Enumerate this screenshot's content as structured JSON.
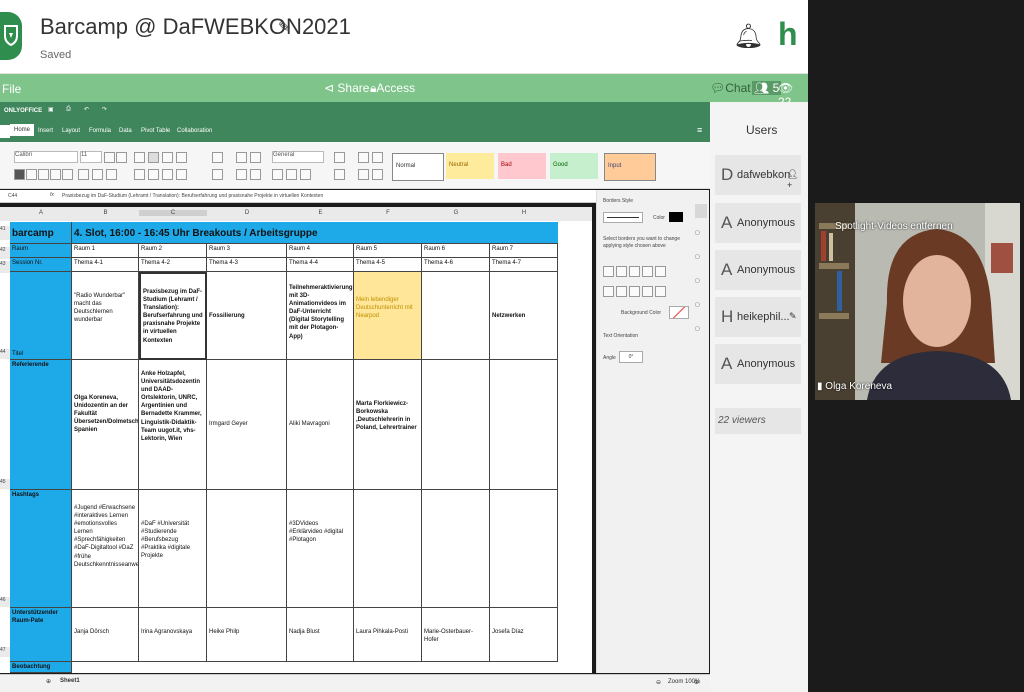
{
  "header": {
    "title": "Barcamp @ DaFWEBKON2021",
    "status": "Saved",
    "brand_letter": "h"
  },
  "menubar": {
    "file": "File",
    "share": "Share",
    "access": "Access",
    "chat": "Chat",
    "users": "5",
    "viewers": "22"
  },
  "office": {
    "app_name": "ONLYOFFICE",
    "tabs": [
      "Home",
      "Insert",
      "Layout",
      "Formula",
      "Data",
      "Pivot Table",
      "Collaboration"
    ],
    "font": "Calibri",
    "font_size": "11",
    "number_format": "General",
    "styles": [
      {
        "label": "Normal",
        "bg": "#ffffff",
        "color": "#222"
      },
      {
        "label": "Neutral",
        "bg": "#ffeb9c",
        "color": "#9c6500"
      },
      {
        "label": "Bad",
        "bg": "#ffc7ce",
        "color": "#9c0006"
      },
      {
        "label": "Good",
        "bg": "#c6efce",
        "color": "#006100"
      },
      {
        "label": "Input",
        "bg": "#ffcc99",
        "color": "#3f3f76"
      }
    ],
    "cell_ref": "C44",
    "formula": "Praxisbezug im DaF-Studium (Lehramt / Translation): Berufserfahrung und praxisnahe Projekte in virtuellen Kontexten"
  },
  "panel": {
    "borders_style": "Borders Style",
    "color": "Color",
    "hint": "Select borders you want to change applying style chosen above",
    "background_color": "Background Color",
    "text_orientation": "Text Orientation",
    "angle_label": "Angle",
    "angle_value": "0°"
  },
  "sheet": {
    "columns": [
      "A",
      "B",
      "C",
      "D",
      "E",
      "F",
      "G",
      "H"
    ],
    "rows": [
      "41",
      "42",
      "43",
      "44",
      "45",
      "46",
      "47"
    ],
    "title_a": "barcamp",
    "title_b": "4. Slot, 16:00 - 16:45 Uhr  Breakouts / Arbeitsgruppe",
    "raum_label": "Raum",
    "rooms": [
      "Raum 1",
      "Raum 2",
      "Raum 3",
      "Raum 4",
      "Raum 5",
      "Raum 6",
      "Raum 7"
    ],
    "session_label": "Session Nr.",
    "sessions": [
      "Thema 4-1",
      "Thema 4-2",
      "Thema 4-3",
      "Thema 4-4",
      "Thema 4-5",
      "Thema 4-6",
      "Thema 4-7"
    ],
    "titel_label": "Titel",
    "titles": [
      "\"Radio Wunderbar\" macht das Deutschlernen wunderbar",
      "Praxisbezug im DaF-Studium (Lehramt / Translation): Berufserfahrung und praxisnahe Projekte in virtuellen Kontexten",
      "Fossilierung",
      "Teilnehmeraktivierung mit 3D-Animationvideos im DaF-Unterricht (Digital Storytelling mit der Plotagon-App)",
      "Mein lebendiger Deutschunterricht mit Nearpod",
      "",
      "Netzwerken"
    ],
    "ref_label": "Referierende",
    "refs": [
      "Olga Koreneva, Unidozentin an der Fakultät Übersetzen/Dolmetschen, Spanien",
      "Anke Holzapfel, Universitätsdozentin und DAAD-Ortslektorin, UNRC, Argentinien und Bernadette Krammer, Linguistik-Didaktik-Team uugot.it, vhs-Lektorin, Wien",
      "Irmgard Geyer",
      "Aliki Mavragoni",
      "Marta Florkiewicz-Borkowska ,Deutschlehrerin in Poland, Lehrertrainer",
      "",
      ""
    ],
    "hashtag_label": "Hashtags",
    "hashtags": [
      "#Jugend #Erwachsene #interaktives Lernen #emotionsvolles Lernen #Sprechfähigkeiten #DaF-Digitaltool #DaZ #frühe Deutschkenntnisseanwendung",
      "#DaF #Universität #Studierende #Berufsbezug #Praktika #digitale Projekte",
      "",
      "#3DVideos #Erklärvideo #digital #Plotagon",
      "",
      "",
      ""
    ],
    "pate_label": "Unterstützender Raum-Pate",
    "paten": [
      "Janja Dörsch",
      "Irina Agranovskaya",
      "Heike Philp",
      "Nadja Blust",
      "Laura Pihkala-Posti",
      "Marie-Osterbauer-Hofer",
      "Josefa Díaz"
    ],
    "next_label": "Beobachtung"
  },
  "bottom": {
    "sheet_tab": "Sheet1",
    "zoom": "Zoom 100%"
  },
  "users_panel": {
    "title": "Users",
    "list": [
      {
        "initial": "D",
        "name": "dafwebkon",
        "icon": "add-user-icon"
      },
      {
        "initial": "A",
        "name": "Anonymous",
        "icon": ""
      },
      {
        "initial": "A",
        "name": "Anonymous",
        "icon": ""
      },
      {
        "initial": "H",
        "name": "heikephil...",
        "icon": "pencil-icon"
      },
      {
        "initial": "A",
        "name": "Anonymous",
        "icon": ""
      }
    ],
    "viewers": "22 viewers"
  },
  "video": {
    "overlay": "Spotlight-Videos entfernen",
    "speaker": "Olga Koreneva"
  },
  "colors": {
    "accent": "#2f8e4e",
    "bar": "#7fc48a",
    "office_green": "#40865c",
    "highlight_blue": "#1ea9e9",
    "highlight_yellow": "#ffe699"
  }
}
